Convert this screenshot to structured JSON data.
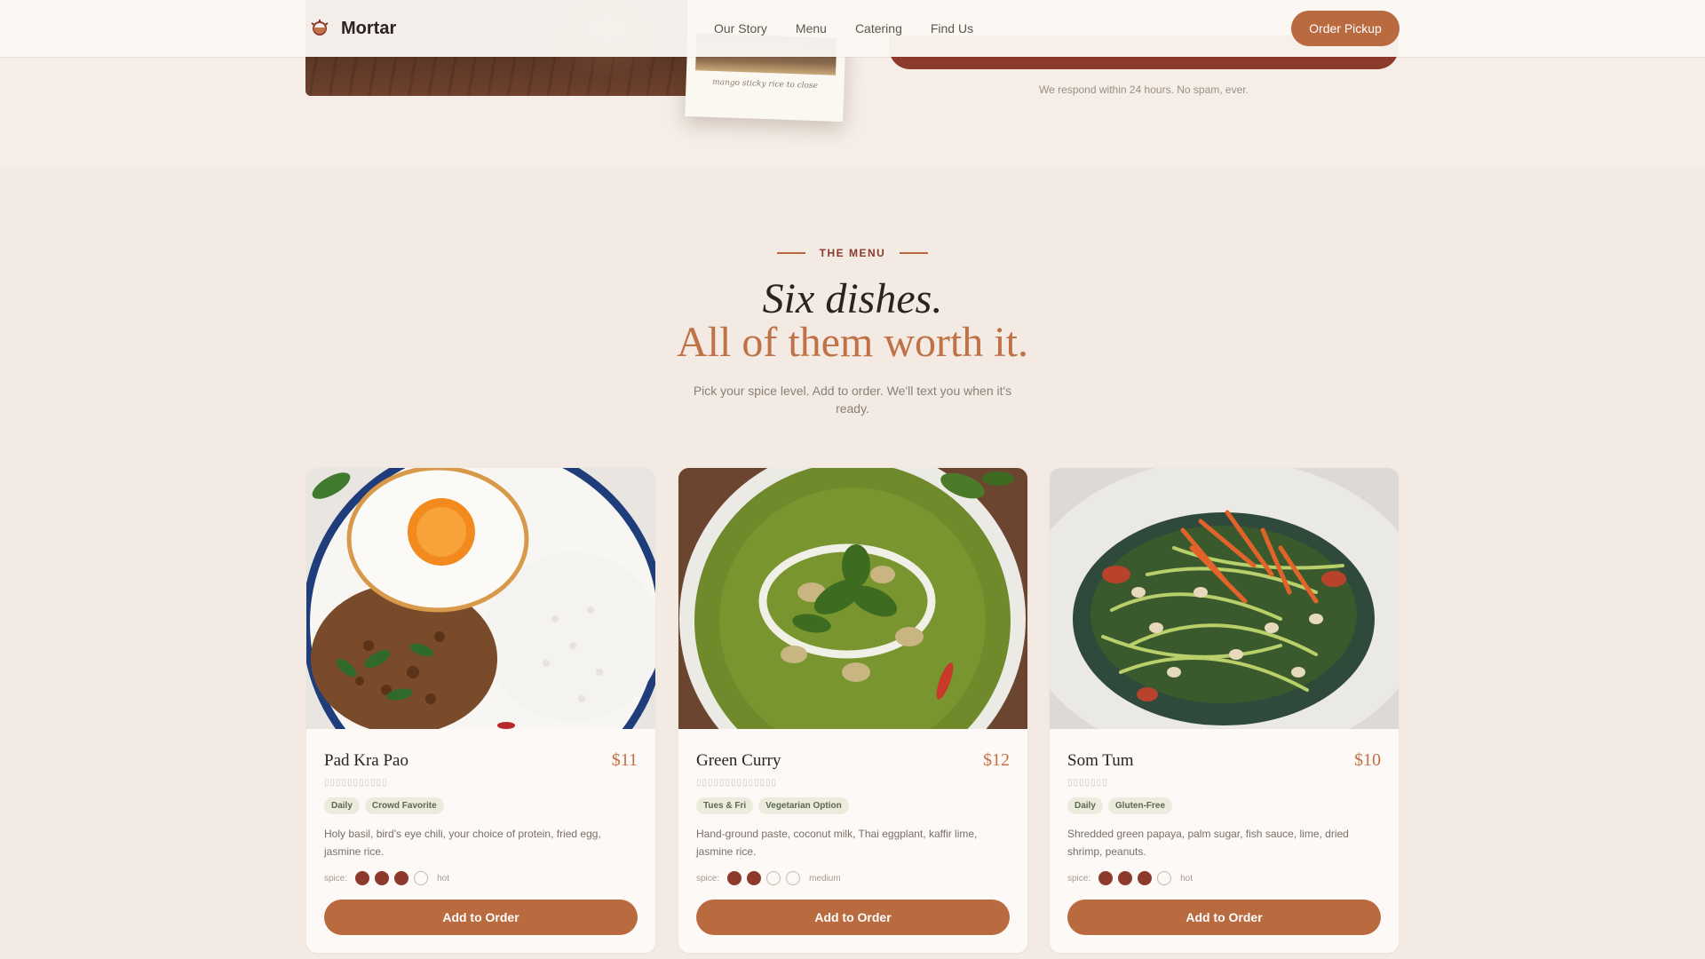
{
  "nav": {
    "brand": "Mortar",
    "links": [
      "Our Story",
      "Menu",
      "Catering",
      "Find Us"
    ],
    "cta": "Order Pickup"
  },
  "previous_section": {
    "polaroid_caption": "mango sticky rice to close",
    "respond_note": "We respond within 24 hours. No spam, ever."
  },
  "menu": {
    "eyebrow": "THE MENU",
    "headline_line1": "Six dishes.",
    "headline_line2": "All of them worth it.",
    "subhead": "Pick your spice level. Add to order. We'll text you when it's ready.",
    "spice_label": "spice:",
    "add_label": "Add to Order",
    "cards": [
      {
        "name": "Pad Kra Pao",
        "price": "$11",
        "tags": [
          "Daily",
          "Crowd Favorite"
        ],
        "description": "Holy basil, bird's eye chili, your choice of protein, fried egg, jasmine rice.",
        "spice": 3,
        "spice_max": 4,
        "spice_level": "hot"
      },
      {
        "name": "Green Curry",
        "price": "$12",
        "tags": [
          "Tues & Fri",
          "Vegetarian Option"
        ],
        "description": "Hand-ground paste, coconut milk, Thai eggplant, kaffir lime, jasmine rice.",
        "spice": 2,
        "spice_max": 4,
        "spice_level": "medium"
      },
      {
        "name": "Som Tum",
        "price": "$10",
        "tags": [
          "Daily",
          "Gluten-Free"
        ],
        "description": "Shredded green papaya, palm sugar, fish sauce, lime, dried shrimp, peanuts.",
        "spice": 3,
        "spice_max": 4,
        "spice_level": "hot"
      }
    ]
  },
  "colors": {
    "accent": "#b96a3f",
    "spice_on": "#8b3a2c",
    "headline_accent": "#c07145",
    "background": "#f3ebe3"
  }
}
